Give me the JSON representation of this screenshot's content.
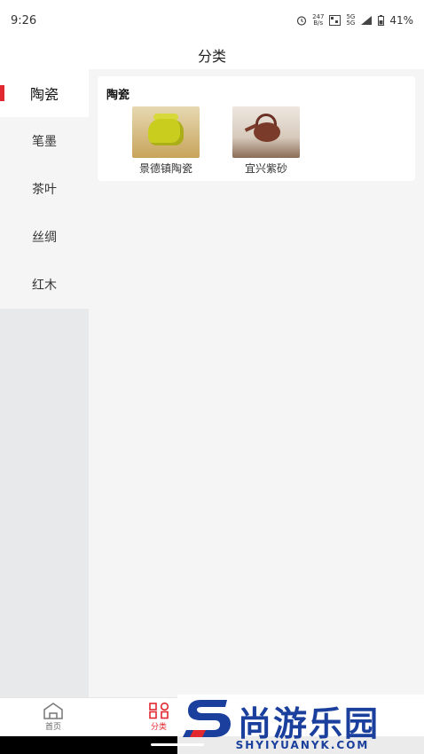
{
  "status": {
    "time": "9:26",
    "speed_top": "247",
    "speed_unit": "B/s",
    "net_top": "5G",
    "net_bottom": "5G",
    "battery": "41%"
  },
  "header": {
    "title": "分类"
  },
  "sidebar": {
    "items": [
      {
        "label": "陶瓷",
        "active": true
      },
      {
        "label": "笔墨"
      },
      {
        "label": "茶叶"
      },
      {
        "label": "丝绸"
      },
      {
        "label": "红木"
      }
    ]
  },
  "content": {
    "section_title": "陶瓷",
    "products": [
      {
        "label": "景德镇陶瓷"
      },
      {
        "label": "宜兴紫砂"
      }
    ]
  },
  "tabbar": {
    "tabs": [
      {
        "label": "首页"
      },
      {
        "label": "分类",
        "active": true
      }
    ]
  },
  "watermark": {
    "main": "尚游乐园",
    "sub": "SHYIYUANYK.COM"
  },
  "colors": {
    "accent": "#e0282e",
    "watermark": "#1a3f9c"
  }
}
